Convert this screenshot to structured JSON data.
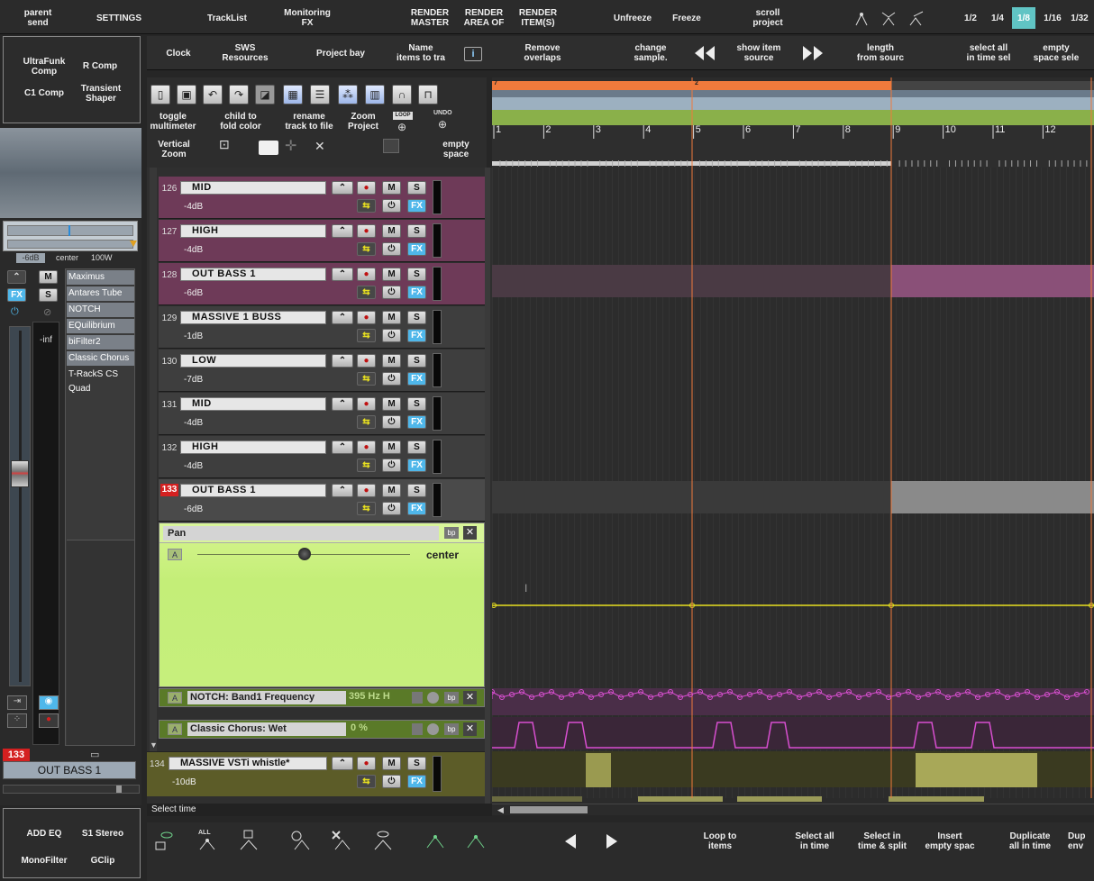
{
  "topbar": {
    "parent_send": "parent\nsend",
    "settings": "SETTINGS",
    "tracklist": "TrackList",
    "monitoring_fx": "Monitoring\nFX",
    "render_master": "RENDER\nMASTER",
    "render_area": "RENDER\nAREA OF",
    "render_items": "RENDER\nITEM(S)",
    "unfreeze": "Unfreeze",
    "freeze": "Freeze",
    "scroll_project": "scroll\nproject",
    "grid": [
      "1/2",
      "1/4",
      "1/8",
      "1/16",
      "1/32"
    ],
    "grid_active": "1/8"
  },
  "toolbar2": {
    "clock": "Clock",
    "sws": "SWS\nResources",
    "project_bay": "Project bay",
    "name_items": "Name\nitems to tra",
    "remove_overlaps": "Remove\noverlaps",
    "change_sample": "change\nsample.",
    "show_item_source": "show item\nsource",
    "length_from_source": "length\nfrom sourc",
    "select_all_time": "select all\nin time sel",
    "empty_space": "empty\nspace sele"
  },
  "fx_left": {
    "ultrafunk": "UltraFunk\nComp",
    "rcomp": "R Comp",
    "c1comp": "C1 Comp",
    "transient": "Transient\nShaper"
  },
  "tcp_tools": {
    "toggle_multimeter": "toggle\nmultimeter",
    "child_to_fold": "child to\nfold color",
    "rename_track": "rename\ntrack to file",
    "zoom_project": "Zoom\nProject",
    "loop": "LOOP",
    "undo": "UNDO",
    "vertical_zoom": "Vertical\nZoom",
    "empty_space": "empty\nspace"
  },
  "mcp": {
    "vol_db": "-6dB",
    "pan": "center",
    "width": "100W",
    "fx_chain": [
      "Maximus",
      "Antares Tube",
      "NOTCH",
      "EQuilibrium",
      "biFilter2",
      "Classic Chorus",
      "T-RackS CS Quad"
    ],
    "peak": "-inf",
    "track_num": "133",
    "track_name": "OUT BASS 1"
  },
  "tracks": [
    {
      "num": "126",
      "name": "MID",
      "vol": "-4dB"
    },
    {
      "num": "127",
      "name": "HIGH",
      "vol": "-4dB"
    },
    {
      "num": "128",
      "name": "OUT BASS 1",
      "vol": "-6dB"
    },
    {
      "num": "129",
      "name": "MASSIVE 1 BUSS",
      "vol": "-1dB"
    },
    {
      "num": "130",
      "name": "LOW",
      "vol": "-7dB"
    },
    {
      "num": "131",
      "name": "MID",
      "vol": "-4dB"
    },
    {
      "num": "132",
      "name": "HIGH",
      "vol": "-4dB"
    },
    {
      "num": "133",
      "name": "OUT BASS 1",
      "vol": "-6dB"
    }
  ],
  "envelope": {
    "name": "Pan",
    "value": "center",
    "bp": "bp",
    "lane_a": "A"
  },
  "env2": {
    "name": "NOTCH: Band1 Frequency",
    "value": "395 Hz H"
  },
  "env3": {
    "name": "Classic Chorus: Wet",
    "value": "0 %"
  },
  "track134": {
    "num": "134",
    "name": "MASSIVE VSTi whistle*",
    "vol": "-10dB"
  },
  "buttons": {
    "m": "M",
    "s": "S",
    "fx": "FX"
  },
  "ruler": {
    "marker1": "7",
    "marker2": "2",
    "bars": [
      "1",
      "2",
      "3",
      "4",
      "5",
      "6",
      "7",
      "8",
      "9",
      "10",
      "11",
      "12"
    ]
  },
  "status": "Select time",
  "bottom_fx": {
    "add_eq": "ADD EQ",
    "s1_stereo": "S1 Stereo",
    "monofilter": "MonoFilter",
    "gclip": "GClip"
  },
  "bottombar": {
    "all": "ALL",
    "loop_items": "Loop to\nitems",
    "select_all_time": "Select all\nin time",
    "select_split": "Select in\ntime & split",
    "insert_empty": "Insert\nempty spac",
    "duplicate": "Duplicate\nall in time",
    "dup_env": "Dup\nenv"
  },
  "colors": {
    "accent": "#4fb7ea",
    "orange": "#f07a3c",
    "purple": "#6e3a58",
    "green": "#c4ee78",
    "yellow": "#e8e020",
    "pink": "#d84fd0"
  }
}
